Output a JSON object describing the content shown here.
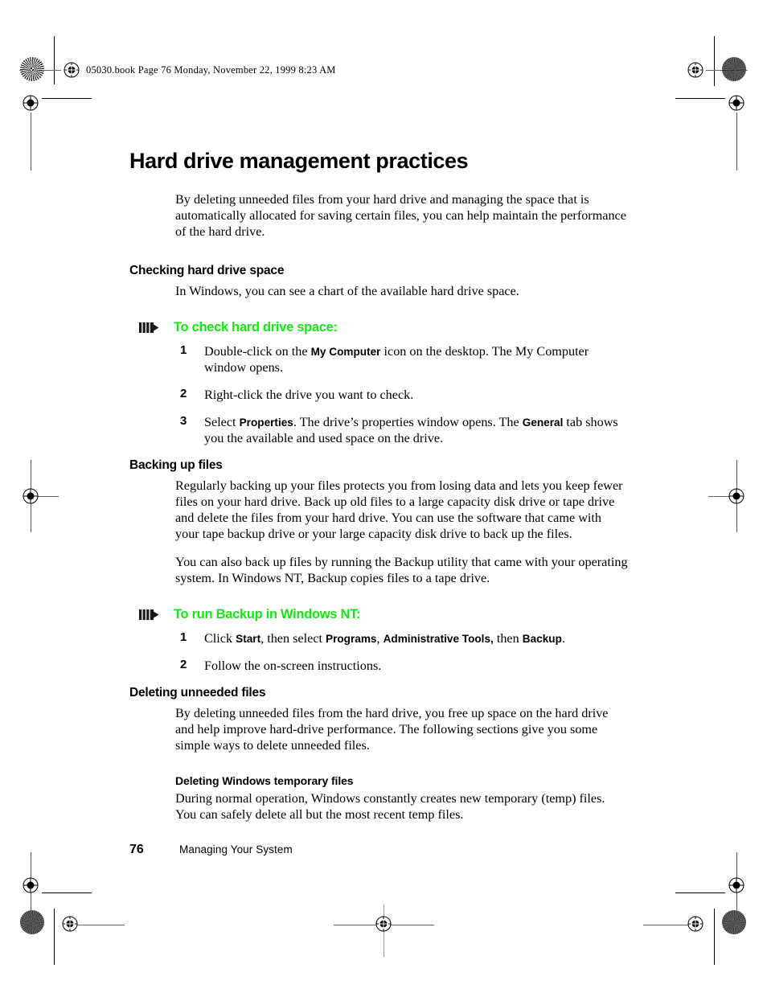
{
  "running_header": "05030.book  Page 76  Monday, November 22, 1999  8:23 AM",
  "title": "Hard drive management practices",
  "intro": "By deleting unneeded files from your hard drive and managing the space that is automatically allocated for saving certain files, you can help maintain the performance of the hard drive.",
  "accent_green": "#14E614",
  "sections": [
    {
      "heading": "Checking hard drive space",
      "body": "In Windows, you can see a chart of the available hard drive space.",
      "procedure": {
        "icon": "bars-arrow-icon",
        "label": "To check hard drive space:",
        "steps": [
          {
            "num": "1",
            "pre": "Double-click on the ",
            "ui": "My Computer",
            "post": " icon on the desktop. The My Computer window opens."
          },
          {
            "num": "2",
            "pre": "Right-click the drive you want to check.",
            "ui": "",
            "post": ""
          },
          {
            "num": "3",
            "pre": "Select ",
            "ui": "Properties",
            "post": ". The drive’s properties window opens. The ",
            "ui2": "General",
            "post2": " tab shows you the available and used space on the drive."
          }
        ]
      }
    },
    {
      "heading": "Backing up files",
      "body": "Regularly backing up your files protects you from losing data and lets you keep fewer files on your hard drive. Back up old files to a large capacity disk drive or tape drive and delete the files from your hard drive. You can use the software that came with your tape backup drive or your large capacity disk drive to back up the files.",
      "body2": "You can also back up files by running the Backup utility that came with your operating system. In Windows NT, Backup copies files to a tape drive.",
      "procedure": {
        "icon": "bars-arrow-icon",
        "label": "To run Backup in Windows NT:",
        "steps": [
          {
            "num": "1",
            "pre": "Click ",
            "ui": "Start",
            "post": ", then select ",
            "ui2": "Programs",
            "post2": ", ",
            "ui3": "Administrative Tools,",
            "post3": " then ",
            "ui4": "Backup",
            "post4": "."
          },
          {
            "num": "2",
            "pre": "Follow the on-screen instructions.",
            "ui": "",
            "post": ""
          }
        ]
      }
    },
    {
      "heading": "Deleting unneeded files",
      "body": "By deleting unneeded files from the hard drive, you free up space on the hard drive and help improve hard-drive performance. The following sections give you some simple ways to delete unneeded files.",
      "subsection": {
        "heading": "Deleting Windows temporary files",
        "body": "During normal operation, Windows constantly creates new temporary (temp) files. You can safely delete all but the most recent temp files."
      }
    }
  ],
  "footer": {
    "page_number": "76",
    "book_name": "Managing Your System"
  }
}
